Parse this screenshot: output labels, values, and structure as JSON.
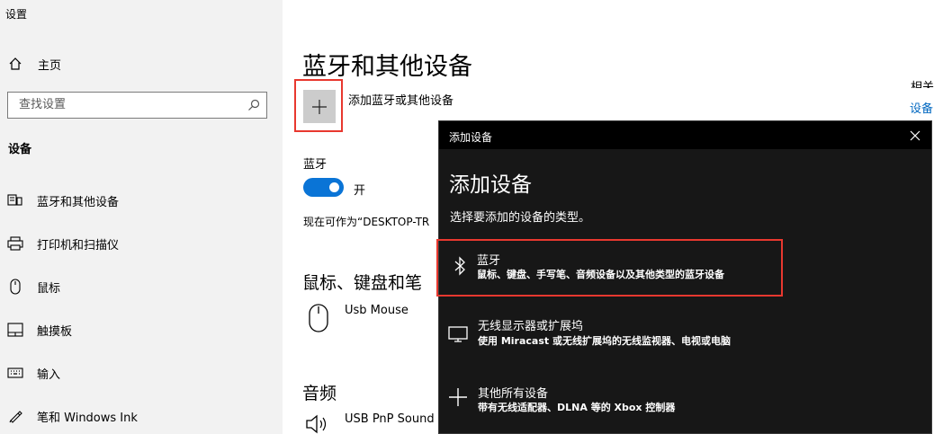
{
  "window": {
    "title": "设置"
  },
  "sidebar": {
    "home_label": "主页",
    "search_placeholder": "查找设置",
    "section": "设备",
    "items": [
      {
        "label": "蓝牙和其他设备",
        "icon": "bluetooth-devices-icon"
      },
      {
        "label": "打印机和扫描仪",
        "icon": "printer-icon"
      },
      {
        "label": "鼠标",
        "icon": "mouse-icon"
      },
      {
        "label": "触摸板",
        "icon": "touchpad-icon"
      },
      {
        "label": "输入",
        "icon": "keyboard-icon"
      },
      {
        "label": "笔和 Windows Ink",
        "icon": "pen-icon"
      }
    ]
  },
  "main": {
    "title": "蓝牙和其他设备",
    "add_device_label": "添加蓝牙或其他设备",
    "bluetooth_heading": "蓝牙",
    "bluetooth_toggle_state": "开",
    "bluetooth_on": true,
    "discoverable_text": "现在可作为“DESKTOP-TR",
    "mouse_section": "鼠标、键盘和笔",
    "mouse_device": "Usb Mouse",
    "audio_section": "音频",
    "audio_device": "USB PnP Sound D",
    "right_edge_text": "相关",
    "right_edge_link": "设备"
  },
  "dialog": {
    "titlebar": "添加设备",
    "heading": "添加设备",
    "description": "选择要添加的设备的类型。",
    "options": [
      {
        "title": "蓝牙",
        "desc": "鼠标、键盘、手写笔、音频设备以及其他类型的蓝牙设备",
        "icon": "bluetooth-icon"
      },
      {
        "title": "无线显示器或扩展坞",
        "desc": "使用 Miracast 或无线扩展坞的无线监视器、电视或电脑",
        "icon": "monitor-icon"
      },
      {
        "title": "其他所有设备",
        "desc": "带有无线适配器、DLNA 等的 Xbox 控制器",
        "icon": "plus-icon"
      }
    ]
  },
  "colors": {
    "accent": "#0a74d6",
    "highlight_border": "#e8382f",
    "dialog_bg": "#171717",
    "sidebar_bg": "#f2f2f2"
  }
}
